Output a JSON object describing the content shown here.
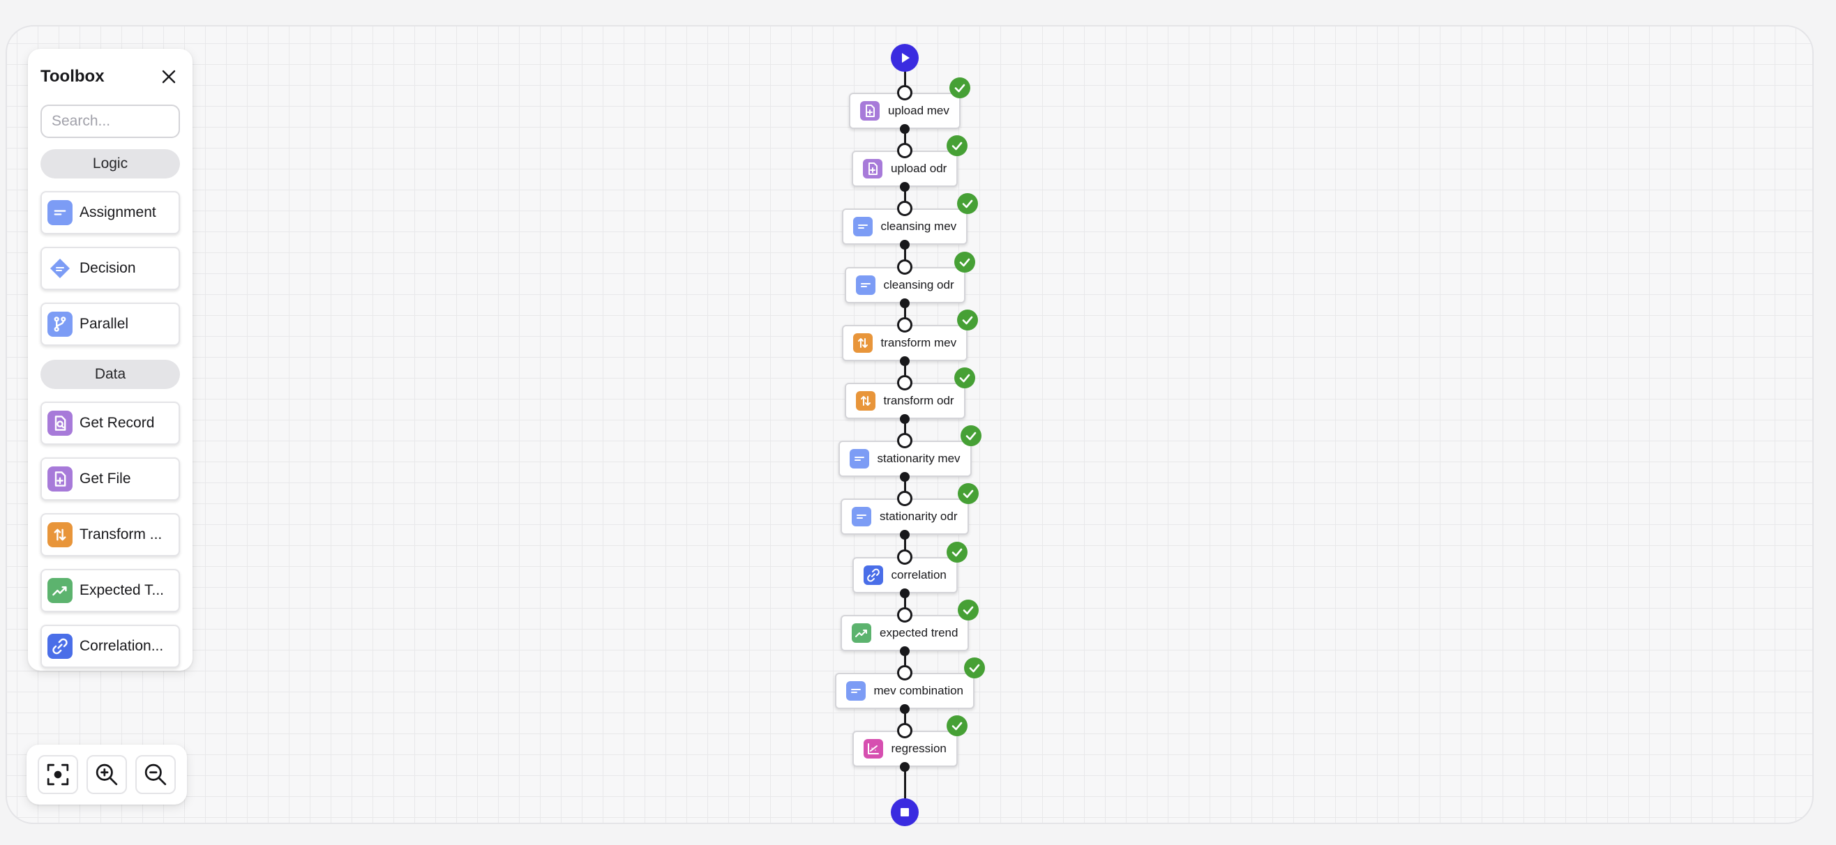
{
  "toolbox": {
    "title": "Toolbox",
    "search_placeholder": "Search...",
    "sections": [
      {
        "label": "Logic",
        "items": [
          {
            "label": "Assignment",
            "icon": "assignment-icon",
            "color": "#7c9cf5"
          },
          {
            "label": "Decision",
            "icon": "decision-icon",
            "color": "#7c9cf5"
          },
          {
            "label": "Parallel",
            "icon": "parallel-icon",
            "color": "#7c9cf5"
          }
        ]
      },
      {
        "label": "Data",
        "items": [
          {
            "label": "Get Record",
            "icon": "get-record-icon",
            "color": "#a77ad9"
          },
          {
            "label": "Get File",
            "icon": "get-file-icon",
            "color": "#a77ad9"
          },
          {
            "label": "Transform ...",
            "icon": "transform-icon",
            "color": "#e8953a"
          },
          {
            "label": "Expected T...",
            "icon": "trend-icon",
            "color": "#5cb36e"
          },
          {
            "label": "Correlation...",
            "icon": "link-icon",
            "color": "#4a6ee8"
          }
        ]
      }
    ]
  },
  "zoom": {
    "buttons": [
      {
        "name": "fit-view",
        "icon": "focus-icon"
      },
      {
        "name": "zoom-in",
        "icon": "zoom-in-icon"
      },
      {
        "name": "zoom-out",
        "icon": "zoom-out-icon"
      }
    ]
  },
  "flow": {
    "start_icon": "play-icon",
    "end_icon": "stop-icon",
    "status_icon": "check-icon",
    "colors": {
      "terminal": "#3a2be0",
      "success": "#46a035",
      "edge": "#18181b"
    },
    "nodes": [
      {
        "label": "upload mev",
        "icon": "get-file-icon",
        "color": "#a77ad9",
        "status": "success"
      },
      {
        "label": "upload odr",
        "icon": "get-file-icon",
        "color": "#a77ad9",
        "status": "success"
      },
      {
        "label": "cleansing mev",
        "icon": "assignment-icon",
        "color": "#7c9cf5",
        "status": "success"
      },
      {
        "label": "cleansing odr",
        "icon": "assignment-icon",
        "color": "#7c9cf5",
        "status": "success"
      },
      {
        "label": "transform mev",
        "icon": "transform-icon",
        "color": "#e8953a",
        "status": "success"
      },
      {
        "label": "transform odr",
        "icon": "transform-icon",
        "color": "#e8953a",
        "status": "success"
      },
      {
        "label": "stationarity mev",
        "icon": "assignment-icon",
        "color": "#7c9cf5",
        "status": "success"
      },
      {
        "label": "stationarity odr",
        "icon": "assignment-icon",
        "color": "#7c9cf5",
        "status": "success"
      },
      {
        "label": "correlation",
        "icon": "link-icon",
        "color": "#4a6ee8",
        "status": "success"
      },
      {
        "label": "expected trend",
        "icon": "trend-icon",
        "color": "#5cb36e",
        "status": "success"
      },
      {
        "label": "mev combination",
        "icon": "assignment-icon",
        "color": "#7c9cf5",
        "status": "success"
      },
      {
        "label": "regression",
        "icon": "regression-icon",
        "color": "#d64fb0",
        "status": "success"
      }
    ]
  }
}
